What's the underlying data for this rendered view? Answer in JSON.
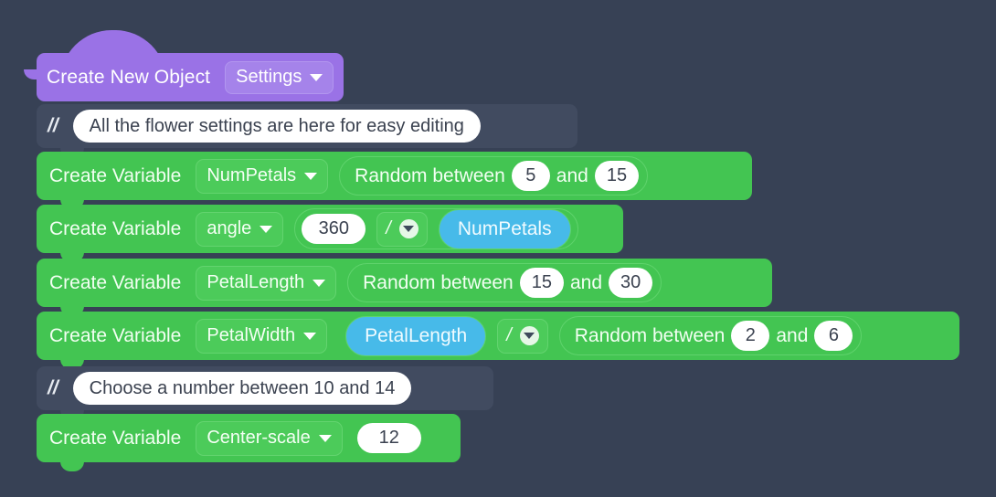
{
  "canvas": {
    "background_color": "#374155"
  },
  "palette": {
    "hat_purple": "#9a72e6",
    "hat_purple_light": "#a583ea",
    "statement_green": "#43c552",
    "statement_green_light": "#4ccb5a",
    "variable_blue": "#47bae9",
    "comment_slate": "#414b60",
    "input_white": "#ffffff",
    "text_light": "#f2fff2",
    "text_dark": "#3b4250"
  },
  "script": {
    "hat": {
      "label": "Create New Object",
      "dropdown": {
        "value": "Settings",
        "icon": "chevron-down-icon"
      }
    },
    "rows": [
      {
        "type": "comment",
        "marker": "//",
        "text": "All the flower settings are here for easy editing"
      },
      {
        "type": "create-variable",
        "label": "Create Variable",
        "variable": "NumPetals",
        "value": {
          "kind": "random",
          "label": "Random between",
          "min": "5",
          "conjunction": "and",
          "max": "15"
        }
      },
      {
        "type": "create-variable",
        "label": "Create Variable",
        "variable": "angle",
        "value": {
          "kind": "operator",
          "left": "360",
          "operator": "/",
          "right_variable": "NumPetals"
        }
      },
      {
        "type": "create-variable",
        "label": "Create Variable",
        "variable": "PetalLength",
        "value": {
          "kind": "random",
          "label": "Random between",
          "min": "15",
          "conjunction": "and",
          "max": "30"
        }
      },
      {
        "type": "create-variable",
        "label": "Create Variable",
        "variable": "PetalWidth",
        "value": {
          "kind": "operator-random",
          "left_variable": "PetalLength",
          "operator": "/",
          "label": "Random between",
          "min": "2",
          "conjunction": "and",
          "max": "6"
        }
      },
      {
        "type": "comment",
        "marker": "//",
        "text": "Choose a number between 10 and 14"
      },
      {
        "type": "create-variable",
        "label": "Create Variable",
        "variable": "Center-scale",
        "value": {
          "kind": "number",
          "number": "12"
        }
      }
    ]
  }
}
